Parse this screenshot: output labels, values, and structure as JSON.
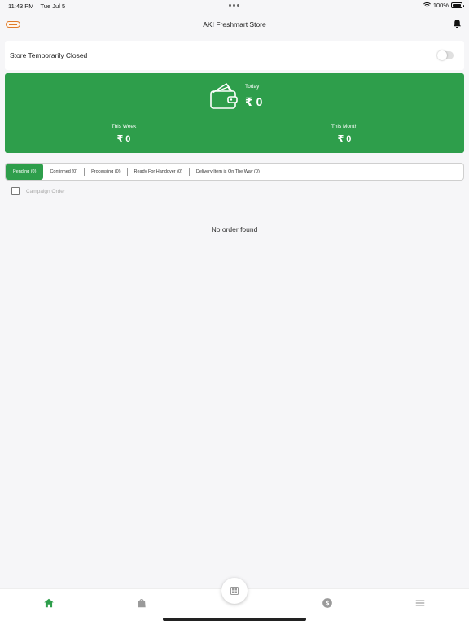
{
  "status_bar": {
    "time": "11:43 PM",
    "date": "Tue Jul 5",
    "battery": "100%"
  },
  "header": {
    "title": "AKI Freshmart Store"
  },
  "store_status": {
    "label": "Store Temporarily Closed",
    "toggle_on": false
  },
  "earnings": {
    "today_label": "Today",
    "today_value": "₹ 0",
    "week_label": "This Week",
    "week_value": "₹ 0",
    "month_label": "This Month",
    "month_value": "₹ 0"
  },
  "tabs": [
    {
      "label": "Pending (0)",
      "active": true
    },
    {
      "label": "Confirmed (0)",
      "active": false
    },
    {
      "label": "Processing (0)",
      "active": false
    },
    {
      "label": "Ready For Handover (0)",
      "active": false
    },
    {
      "label": "Delivery Item is On The Way (0)",
      "active": false
    }
  ],
  "campaign": {
    "label": "Campaign Order",
    "checked": false
  },
  "empty_message": "No order found",
  "colors": {
    "primary_green": "#2e9e4b",
    "background": "#f6f6f8",
    "logo_orange": "#e07b2a"
  },
  "bottom_nav": {
    "items": [
      "home-icon",
      "shopping-bag-icon",
      "pos-icon",
      "dollar-icon",
      "menu-icon"
    ],
    "active": "home-icon"
  }
}
